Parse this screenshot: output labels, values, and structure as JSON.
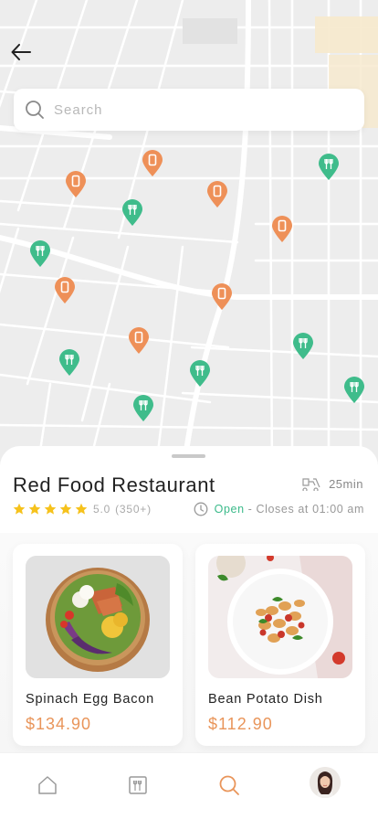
{
  "search": {
    "placeholder": "Search"
  },
  "map": {
    "pins": [
      {
        "type": "shop"
      },
      {
        "type": "shop"
      },
      {
        "type": "restaurant"
      },
      {
        "type": "shop"
      },
      {
        "type": "restaurant"
      },
      {
        "type": "shop"
      },
      {
        "type": "shop"
      },
      {
        "type": "shop"
      },
      {
        "type": "restaurant"
      },
      {
        "type": "shop"
      },
      {
        "type": "restaurant"
      },
      {
        "type": "restaurant"
      },
      {
        "type": "restaurant"
      },
      {
        "type": "restaurant"
      },
      {
        "type": "restaurant"
      }
    ],
    "colors": {
      "shop": "#ee9058",
      "restaurant": "#3fbc8b"
    }
  },
  "restaurant": {
    "name": "Red Food Restaurant",
    "delivery_time": "25min",
    "rating": "5.0",
    "reviews": "(350+)",
    "stars": 5,
    "status": "Open",
    "closes": "- Closes at 01:00 am"
  },
  "dishes": [
    {
      "name": "Spinach Egg Bacon",
      "price": "$134.90"
    },
    {
      "name": "Bean Potato Dish",
      "price": "$112.90"
    }
  ],
  "tabs": [
    {
      "icon": "home-icon"
    },
    {
      "icon": "menu-icon"
    },
    {
      "icon": "search-icon",
      "active": true
    },
    {
      "icon": "avatar"
    }
  ],
  "colors": {
    "accent": "#e9955a",
    "green": "#3bba8a",
    "star": "#f6c21c"
  }
}
